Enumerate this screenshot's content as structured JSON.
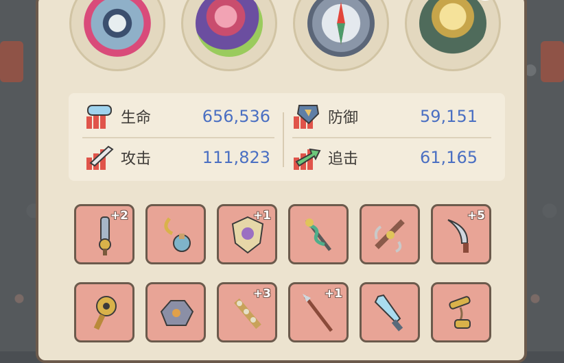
{
  "relics": [
    {
      "name": "eye-ring-relic-icon"
    },
    {
      "name": "gem-fruit-relic-icon"
    },
    {
      "name": "compass-relic-icon"
    },
    {
      "name": "golden-torch-relic-icon",
      "badge": "!"
    }
  ],
  "stats": {
    "hp": {
      "label": "生命",
      "value": "656,536"
    },
    "defense": {
      "label": "防御",
      "value": "59,151"
    },
    "attack": {
      "label": "攻击",
      "value": "111,823"
    },
    "pursuit": {
      "label": "追击",
      "value": "61,165"
    }
  },
  "equipment": [
    {
      "icon": "bomb-sword-icon",
      "plus": "+2"
    },
    {
      "icon": "hook-icon",
      "plus": ""
    },
    {
      "icon": "ornate-shield-icon",
      "plus": "+1"
    },
    {
      "icon": "serpent-staff-icon",
      "plus": ""
    },
    {
      "icon": "winged-cannon-icon",
      "plus": ""
    },
    {
      "icon": "curved-dagger-icon",
      "plus": "+5"
    },
    {
      "icon": "golden-mace-icon",
      "plus": ""
    },
    {
      "icon": "rock-armor-icon",
      "plus": ""
    },
    {
      "icon": "spiked-club-icon",
      "plus": "+3"
    },
    {
      "icon": "spear-icon",
      "plus": "+1"
    },
    {
      "icon": "crystal-sword-icon",
      "plus": ""
    },
    {
      "icon": "nunchaku-icon",
      "plus": ""
    }
  ],
  "colors": {
    "value": "#4a6fc2",
    "slot": "#e8a496",
    "panel": "#ece3cf"
  }
}
